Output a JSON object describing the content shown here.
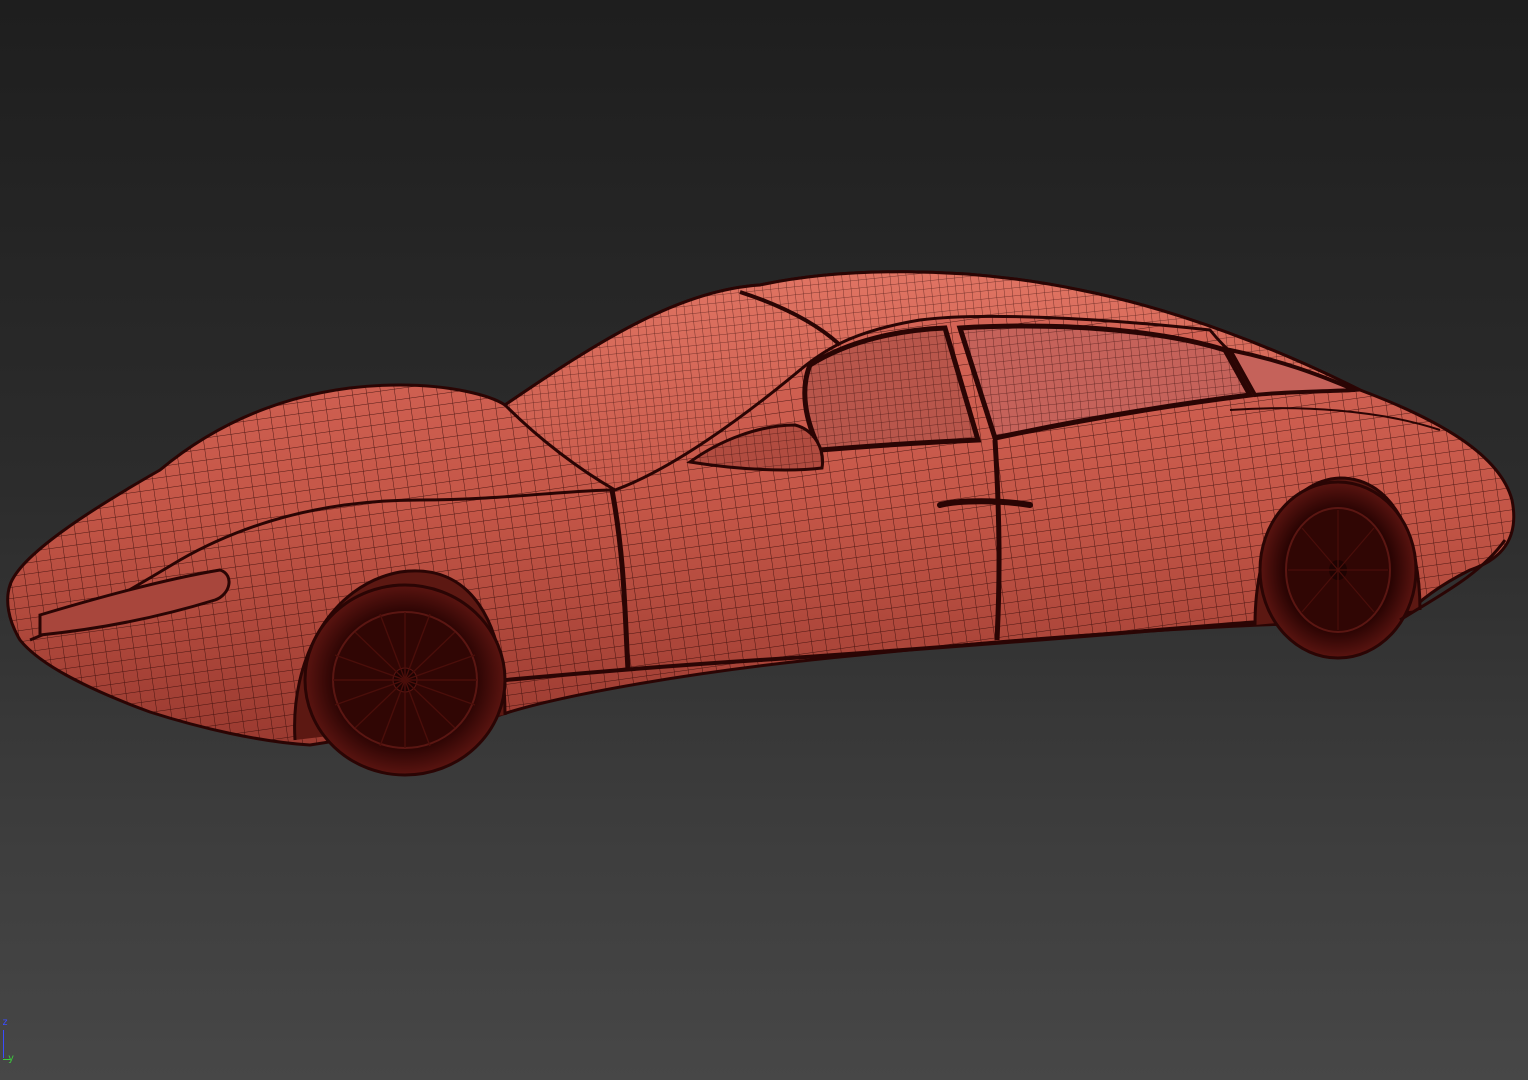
{
  "viewport": {
    "shading_mode": "wireframe-on-shaded",
    "model_color": "#c7574a",
    "wire_color": "#2a0504",
    "background_top": "#1e1e1e",
    "background_bottom": "#474747"
  },
  "axis_gizmo": {
    "z_label": "z",
    "y_label": "y",
    "z_color": "#3a4cff",
    "y_color": "#3cc83c"
  }
}
